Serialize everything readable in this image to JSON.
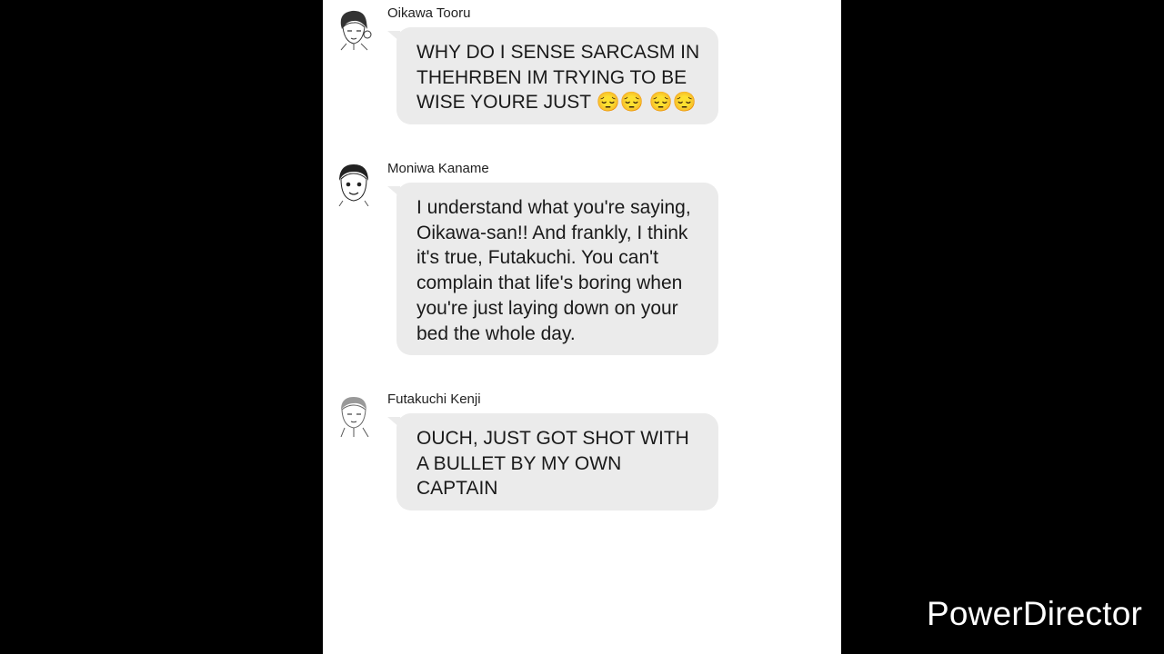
{
  "colors": {
    "background": "#000000",
    "chat_background": "#ffffff",
    "bubble_background": "#ebebeb",
    "text": "#1a1a1a"
  },
  "messages": [
    {
      "sender": "Oikawa Tooru",
      "avatar_icon": "oikawa-avatar-icon",
      "text": "WHY DO I SENSE SARCASM IN THEHRBEN IM TRYING TO BE WISE YOURE JUST 😔😔 😔😔"
    },
    {
      "sender": "Moniwa Kaname",
      "avatar_icon": "moniwa-avatar-icon",
      "text": "I understand what you're saying, Oikawa-san!! And frankly, I think it's true, Futakuchi. You can't complain that life's boring when you're just laying down on your bed the whole day."
    },
    {
      "sender": "Futakuchi Kenji",
      "avatar_icon": "futakuchi-avatar-icon",
      "text": "OUCH, JUST GOT SHOT WITH A BULLET BY MY OWN CAPTAIN"
    }
  ],
  "watermark": "PowerDirector"
}
